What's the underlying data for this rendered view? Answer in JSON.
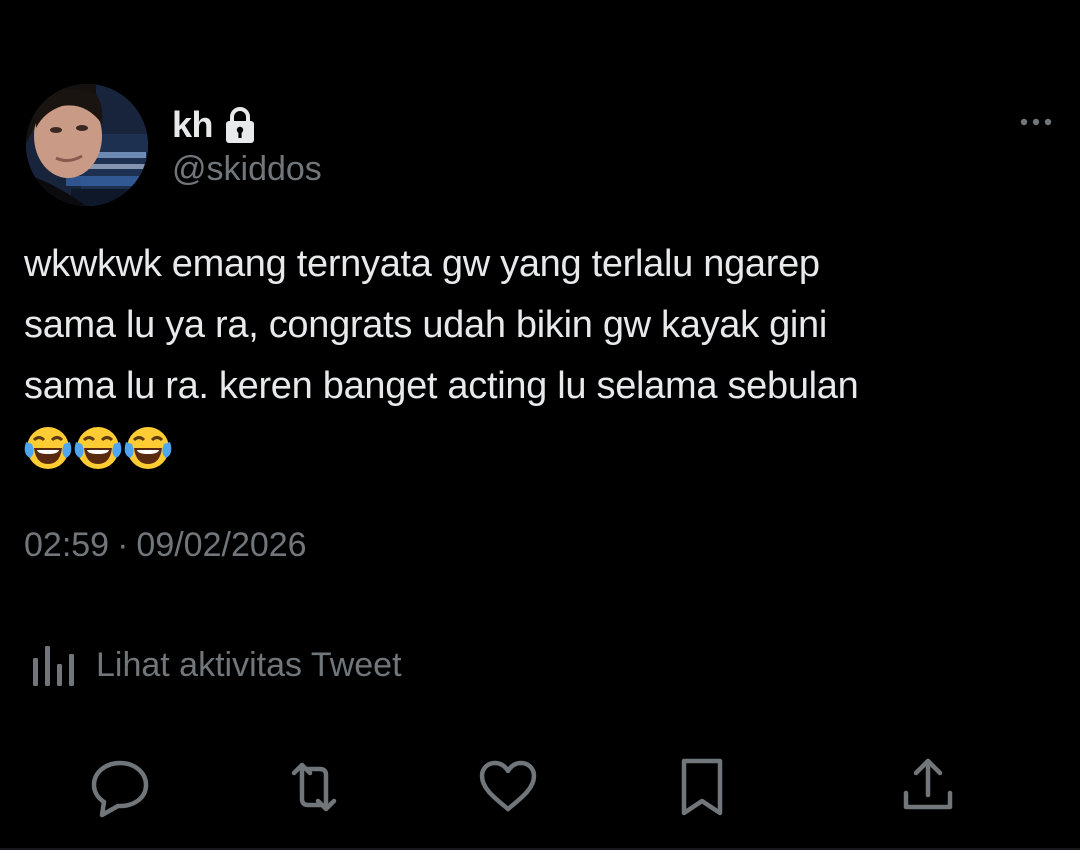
{
  "user": {
    "display_name": "kh",
    "handle": "@skiddos",
    "avatar_icon": "profile-photo",
    "protected_icon": "lock-icon"
  },
  "tweet": {
    "lines": [
      "wkwkwk emang ternyata gw yang terlalu ngarep",
      "sama lu ya ra, congrats udah bikin gw kayak gini",
      "sama lu ra. keren banget acting lu selama sebulan"
    ],
    "emojis": [
      "😂",
      "😂",
      "😂"
    ]
  },
  "meta": {
    "time": "02:59",
    "separator": "·",
    "date": "09/02/2026"
  },
  "activity": {
    "label": "Lihat aktivitas Tweet",
    "icon": "analytics-icon"
  },
  "actions": {
    "reply_icon": "reply-icon",
    "retweet_icon": "retweet-icon",
    "like_icon": "heart-icon",
    "bookmark_icon": "bookmark-icon",
    "share_icon": "share-icon"
  },
  "colors": {
    "background": "#000000",
    "primary_text": "#e7e9ea",
    "secondary_text": "#71767b"
  }
}
